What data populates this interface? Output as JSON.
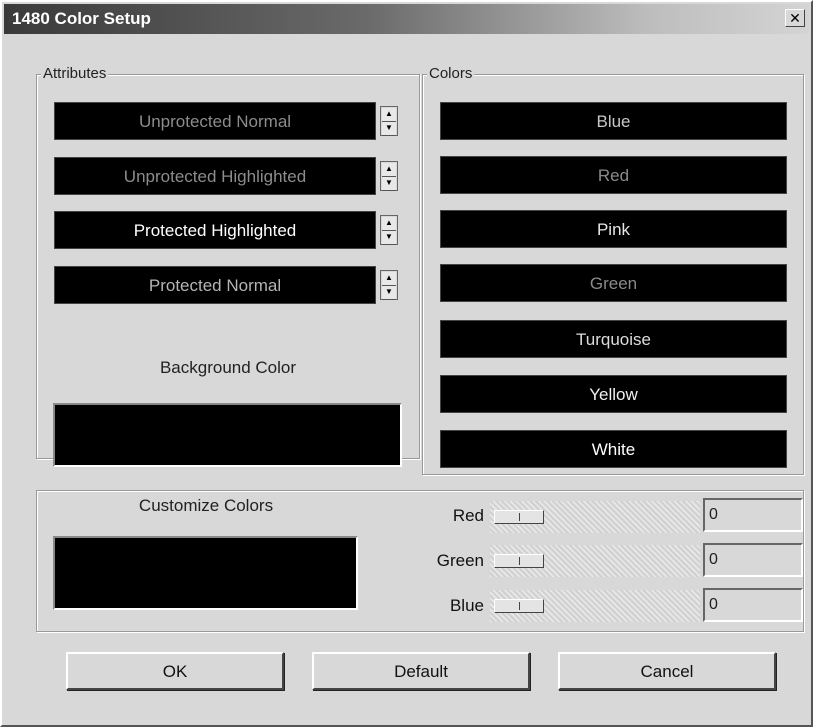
{
  "window": {
    "title": "1480 Color Setup",
    "close_symbol": "✕"
  },
  "attributes": {
    "group_label": "Attributes",
    "items": [
      {
        "label": "Unprotected Normal",
        "color": "#8c8c8c"
      },
      {
        "label": "Unprotected Highlighted",
        "color": "#8c8c8c"
      },
      {
        "label": "Protected Highlighted",
        "color": "#ffffff"
      },
      {
        "label": "Protected Normal",
        "color": "#b4b4b4"
      }
    ],
    "spin_up": "▲",
    "spin_down": "▼",
    "background_label": "Background Color"
  },
  "colors": {
    "group_label": "Colors",
    "items": [
      {
        "label": "Blue",
        "color": "#c8c8c8"
      },
      {
        "label": "Red",
        "color": "#8a8a8a"
      },
      {
        "label": "Pink",
        "color": "#e6e6e6"
      },
      {
        "label": "Green",
        "color": "#8a8a8a"
      },
      {
        "label": "Turquoise",
        "color": "#dcdcdc"
      },
      {
        "label": "Yellow",
        "color": "#f0f0f0"
      },
      {
        "label": "White",
        "color": "#ffffff"
      }
    ]
  },
  "customize": {
    "label": "Customize Colors",
    "channels": [
      {
        "label": "Red",
        "value": "0"
      },
      {
        "label": "Green",
        "value": "0"
      },
      {
        "label": "Blue",
        "value": "0"
      }
    ]
  },
  "buttons": {
    "ok": "OK",
    "default": "Default",
    "cancel": "Cancel"
  }
}
